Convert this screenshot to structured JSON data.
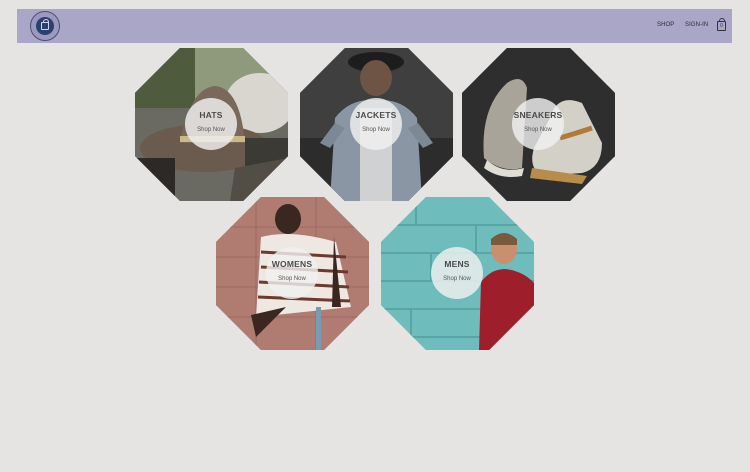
{
  "header": {
    "nav": [
      {
        "label": "SHOP"
      },
      {
        "label": "SIGN-IN"
      }
    ],
    "cart_count": "0",
    "background": "#aaa6c8"
  },
  "collections": [
    {
      "title": "HATS",
      "cta": "Shop Now"
    },
    {
      "title": "JACKETS",
      "cta": "Shop Now"
    },
    {
      "title": "SNEAKERS",
      "cta": "Shop Now"
    },
    {
      "title": "WOMENS",
      "cta": "Shop Now"
    },
    {
      "title": "MENS",
      "cta": "Shop Now"
    }
  ],
  "icons": [
    "brand-logo-icon",
    "shopping-bag-icon"
  ]
}
